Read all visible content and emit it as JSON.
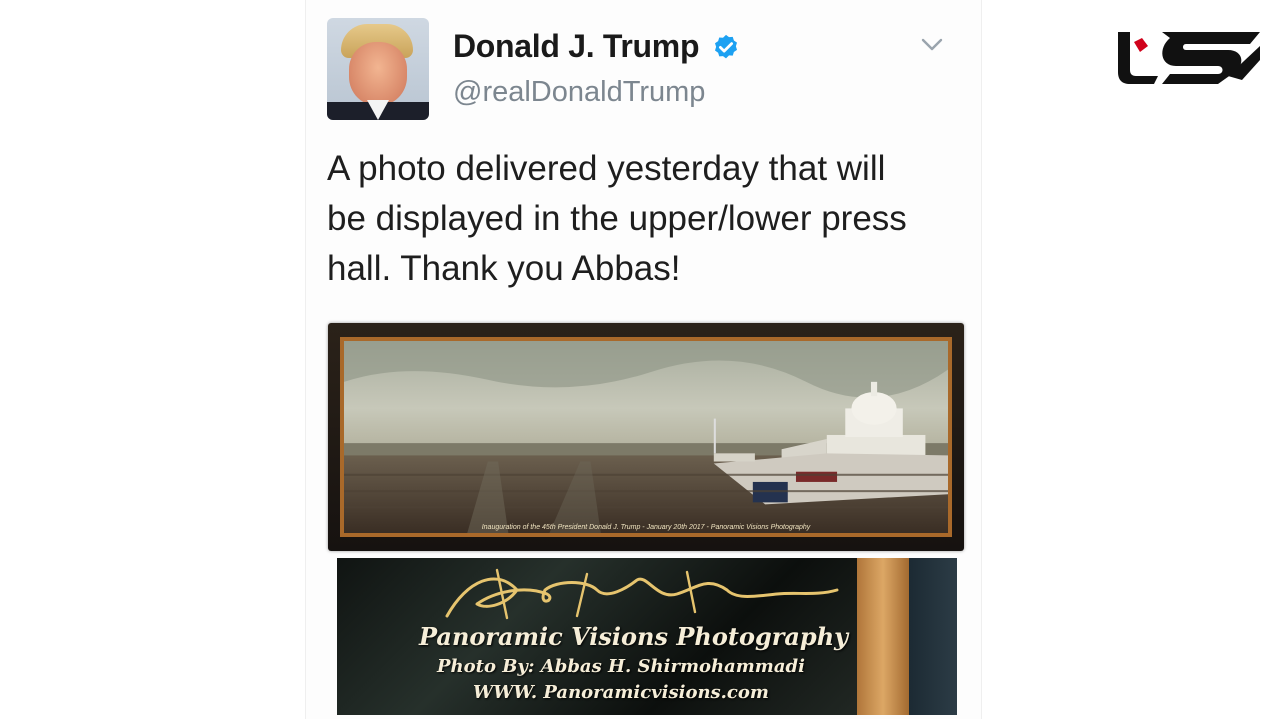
{
  "tweet": {
    "display_name": "Donald J. Trump",
    "handle": "@realDonaldTrump",
    "verified": true,
    "text": "A photo delivered yesterday that will\nbe displayed in the upper/lower press\nhall. Thank you Abbas!",
    "avatar_icon": "profile-photo",
    "menu_icon": "chevron-down-icon"
  },
  "media": {
    "panorama_caption": "Inauguration of the 45th President Donald J. Trump - January 20th 2017 - Panoramic Visions Photography",
    "closeup": {
      "title": "Panoramic Visions Photography",
      "photo_by": "Photo By: Abbas H. Shirmohammadi",
      "url": "WWW. Panoramicvisions.com"
    }
  },
  "brand": {
    "logo_icon": "brand-logo-icon"
  },
  "colors": {
    "verified_blue": "#1da1f2",
    "handle_gray": "#7c868f",
    "text_dark": "#1e1e1e",
    "brand_red": "#d0021b",
    "brand_black": "#111111",
    "frame_wood": "#a9692a"
  }
}
